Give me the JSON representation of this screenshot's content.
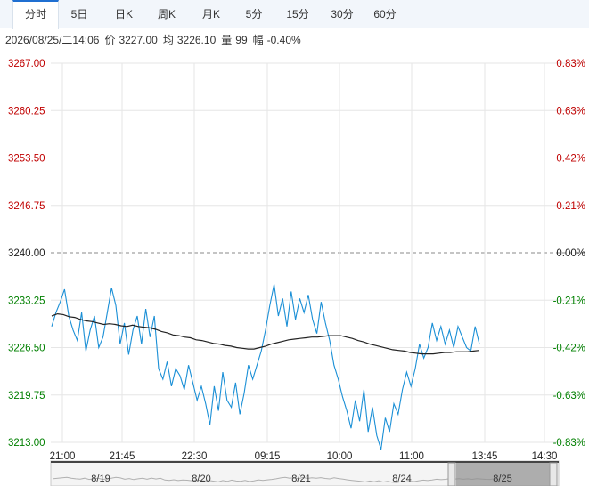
{
  "tabs": [
    {
      "label": "分时",
      "active": true
    },
    {
      "label": "5日",
      "active": false
    },
    {
      "label": "日K",
      "active": false
    },
    {
      "label": "周K",
      "active": false
    },
    {
      "label": "月K",
      "active": false
    },
    {
      "label": "5分",
      "active": false
    },
    {
      "label": "15分",
      "active": false
    },
    {
      "label": "30分",
      "active": false
    },
    {
      "label": "60分",
      "active": false
    }
  ],
  "info": {
    "datetime": "2026/08/25/二14:06",
    "price_label": "价",
    "price": "3227.00",
    "avg_label": "均",
    "avg": "3226.10",
    "volume_label": "量",
    "volume": "99",
    "change_label": "幅",
    "change": "-0.40%"
  },
  "colors": {
    "price_line": "#1a8fd6",
    "avg_line": "#222222",
    "up": "#c00000",
    "down": "#008000",
    "grid": "#e6e6e6",
    "baseline": "#888888"
  },
  "chart_data": {
    "type": "line",
    "y_ticks": [
      "3267.00",
      "3260.25",
      "3253.50",
      "3246.75",
      "3240.00",
      "3233.25",
      "3226.50",
      "3219.75",
      "3213.00"
    ],
    "y_pct_ticks": [
      "0.83%",
      "0.63%",
      "0.42%",
      "0.21%",
      "0.00%",
      "-0.21%",
      "-0.42%",
      "-0.63%",
      "-0.83%"
    ],
    "ylim": [
      3213.0,
      3267.0
    ],
    "prev_close": 3240.0,
    "x_ticks": [
      "21:00",
      "21:45",
      "22:30",
      "09:15",
      "10:00",
      "11:00",
      "13:45",
      "14:30"
    ],
    "grid": true,
    "series": [
      {
        "values": [
          3229.5,
          3231.5,
          3233.0,
          3234.8,
          3231.0,
          3229.0,
          3227.5,
          3231.5,
          3226.0,
          3229.0,
          3231.0,
          3226.5,
          3228.0,
          3231.5,
          3235.0,
          3232.5,
          3227.0,
          3230.0,
          3225.5,
          3229.0,
          3231.0,
          3227.0,
          3232.0,
          3228.0,
          3231.0,
          3223.5,
          3222.0,
          3224.5,
          3221.0,
          3223.5,
          3222.5,
          3220.5,
          3224.0,
          3221.5,
          3219.0,
          3221.0,
          3218.5,
          3215.5,
          3221.0,
          3217.5,
          3223.0,
          3219.0,
          3218.0,
          3221.5,
          3217.0,
          3220.0,
          3224.0,
          3222.0,
          3224.0,
          3226.0,
          3229.0,
          3232.5,
          3235.5,
          3231.0,
          3233.5,
          3229.5,
          3234.5,
          3230.5,
          3233.5,
          3231.5,
          3234.0,
          3230.5,
          3228.5,
          3233.0,
          3230.0,
          3227.5,
          3224.0,
          3222.0,
          3219.5,
          3217.5,
          3215.0,
          3219.0,
          3216.0,
          3220.5,
          3214.5,
          3218.0,
          3214.0,
          3212.0,
          3216.5,
          3214.5,
          3218.5,
          3217.0,
          3220.5,
          3223.0,
          3221.0,
          3223.5,
          3227.0,
          3225.0,
          3226.5,
          3230.0,
          3227.5,
          3229.5,
          3227.0,
          3229.0,
          3226.5,
          3229.5,
          3228.0,
          3226.5,
          3226.0,
          3229.5,
          3227.0
        ]
      },
      {
        "values": [
          3231.0,
          3231.3,
          3231.2,
          3230.9,
          3230.8,
          3230.5,
          3230.3,
          3230.2,
          3230.0,
          3229.8,
          3229.9,
          3229.8,
          3229.6,
          3229.5,
          3229.7,
          3229.5,
          3229.4,
          3229.3,
          3229.1,
          3228.8,
          3228.6,
          3228.3,
          3228.2,
          3228.0,
          3227.9,
          3227.6,
          3227.5,
          3227.3,
          3227.1,
          3227.0,
          3226.8,
          3226.7,
          3226.5,
          3226.4,
          3226.3,
          3226.3,
          3226.5,
          3226.7,
          3227.0,
          3227.2,
          3227.4,
          3227.6,
          3227.7,
          3227.8,
          3227.9,
          3228.0,
          3228.0,
          3228.1,
          3228.2,
          3228.2,
          3228.2,
          3228.0,
          3227.8,
          3227.5,
          3227.3,
          3227.0,
          3226.8,
          3226.6,
          3226.4,
          3226.2,
          3226.1,
          3226.0,
          3225.8,
          3225.7,
          3225.6,
          3225.6,
          3225.6,
          3225.7,
          3225.8,
          3225.8,
          3225.9,
          3225.9,
          3225.9,
          3226.0,
          3226.1
        ]
      }
    ]
  },
  "navigator": {
    "dates": [
      "8/19",
      "8/20",
      "8/21",
      "8/24",
      "8/25"
    ]
  }
}
